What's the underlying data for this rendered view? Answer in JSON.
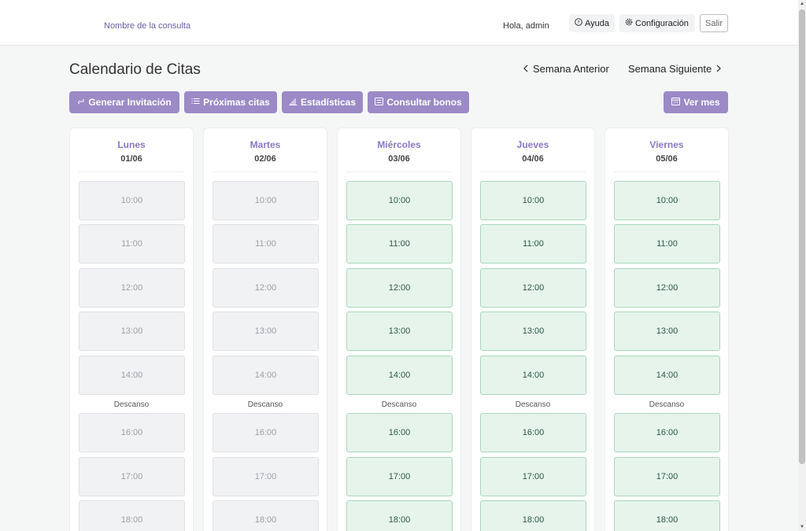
{
  "topbar": {
    "brand": "Nombre de la consulta",
    "greeting": "Hola, admin",
    "help_label": "Ayuda",
    "help_icon": "question-circle-icon",
    "settings_label": "Configuración",
    "settings_icon": "gear-icon",
    "logout_label": "Salir"
  },
  "header": {
    "title": "Calendario de Citas",
    "prev_week": "Semana Anterior",
    "next_week": "Semana Siguiente"
  },
  "actions": {
    "invite": "Generar Invitación",
    "upcoming": "Próximas citas",
    "stats": "Estadísticas",
    "vouchers": "Consultar bonos",
    "month": "Ver mes"
  },
  "break_label": "Descanso",
  "days": [
    {
      "name": "Lunes",
      "date": "01/06",
      "slots": [
        {
          "time": "10:00",
          "available": false
        },
        {
          "time": "11:00",
          "available": false
        },
        {
          "time": "12:00",
          "available": false
        },
        {
          "time": "13:00",
          "available": false
        },
        {
          "time": "14:00",
          "available": false
        },
        {
          "time": "16:00",
          "available": false
        },
        {
          "time": "17:00",
          "available": false
        },
        {
          "time": "18:00",
          "available": false
        }
      ]
    },
    {
      "name": "Martes",
      "date": "02/06",
      "slots": [
        {
          "time": "10:00",
          "available": false
        },
        {
          "time": "11:00",
          "available": false
        },
        {
          "time": "12:00",
          "available": false
        },
        {
          "time": "13:00",
          "available": false
        },
        {
          "time": "14:00",
          "available": false
        },
        {
          "time": "16:00",
          "available": false
        },
        {
          "time": "17:00",
          "available": false
        },
        {
          "time": "18:00",
          "available": false
        }
      ]
    },
    {
      "name": "Miércoles",
      "date": "03/06",
      "slots": [
        {
          "time": "10:00",
          "available": true
        },
        {
          "time": "11:00",
          "available": true
        },
        {
          "time": "12:00",
          "available": true
        },
        {
          "time": "13:00",
          "available": true
        },
        {
          "time": "14:00",
          "available": true
        },
        {
          "time": "16:00",
          "available": true
        },
        {
          "time": "17:00",
          "available": true
        },
        {
          "time": "18:00",
          "available": true
        }
      ]
    },
    {
      "name": "Jueves",
      "date": "04/06",
      "slots": [
        {
          "time": "10:00",
          "available": true
        },
        {
          "time": "11:00",
          "available": true
        },
        {
          "time": "12:00",
          "available": true
        },
        {
          "time": "13:00",
          "available": true
        },
        {
          "time": "14:00",
          "available": true
        },
        {
          "time": "16:00",
          "available": true
        },
        {
          "time": "17:00",
          "available": true
        },
        {
          "time": "18:00",
          "available": true
        }
      ]
    },
    {
      "name": "Viernes",
      "date": "05/06",
      "slots": [
        {
          "time": "10:00",
          "available": true
        },
        {
          "time": "11:00",
          "available": true
        },
        {
          "time": "12:00",
          "available": true
        },
        {
          "time": "13:00",
          "available": true
        },
        {
          "time": "14:00",
          "available": true
        },
        {
          "time": "16:00",
          "available": true
        },
        {
          "time": "17:00",
          "available": true
        },
        {
          "time": "18:00",
          "available": true
        }
      ]
    }
  ],
  "colors": {
    "accent": "#9b8ac6",
    "available_bg": "#e6f4ec",
    "unavailable_bg": "#f1f2f4"
  }
}
